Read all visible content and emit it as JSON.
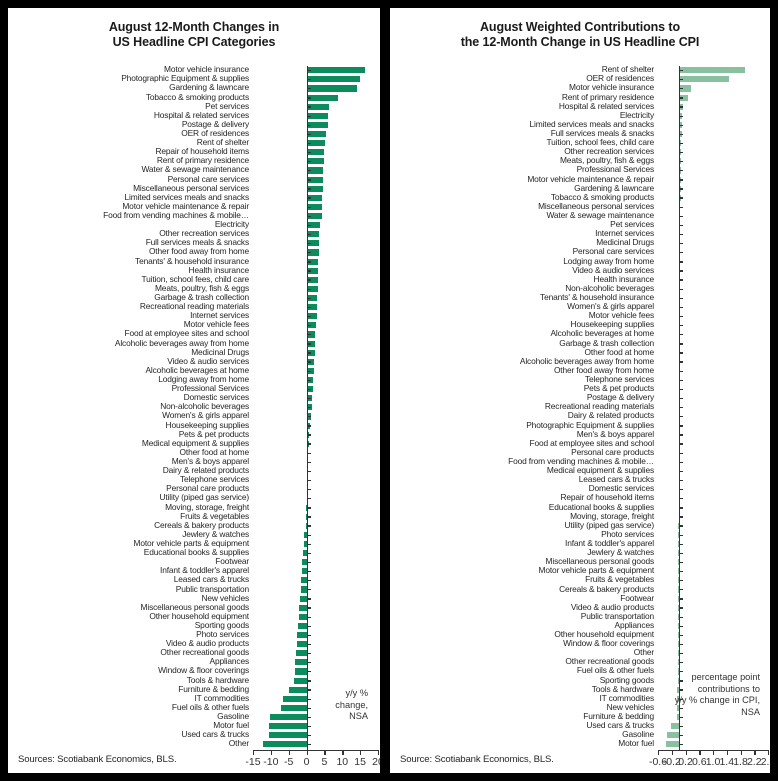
{
  "left": {
    "title_line1": "August 12-Month Changes in",
    "title_line2": "US Headline CPI Categories",
    "note": "y/y %\nchange,\nNSA",
    "source": "Sources: Scotiabank Economics, BLS.",
    "bar_color": "#0c8b5c",
    "chart_data": {
      "type": "bar",
      "title": "August 12-Month Changes in US Headline CPI Categories",
      "xlabel": "y/y % change, NSA",
      "ylabel": "",
      "orientation": "horizontal",
      "xlim": [
        -15,
        20
      ],
      "xticks": [
        -15,
        -10,
        -5,
        0,
        5,
        10,
        15,
        20
      ],
      "grid": false,
      "legend": "none",
      "categories": [
        "Motor vehicle insurance",
        "Photographic Equipment & supplies",
        "Gardening & lawncare",
        "Tobacco & smoking products",
        "Pet services",
        "Hospital & related services",
        "Postage & delivery",
        "OER of residences",
        "Rent of shelter",
        "Repair of household items",
        "Rent of  primary residence",
        "Water & sewage maintenance",
        "Personal care services",
        "Miscellaneous personal services",
        "Limited services meals and snacks",
        "Motor vehicle maintenance & repair",
        "Food from vending machines & mobile…",
        "Electricity",
        "Other recreation services",
        "Full services meals & snacks",
        "Other food away from home",
        "Tenants' & household insurance",
        "Health insurance",
        "Tuition, school fees, child care",
        "Meats, poultry, fish & eggs",
        "Garbage & trash collection",
        "Recreational reading materials",
        "Internet services",
        "Motor vehicle fees",
        "Food at employee sites and school",
        "Alcoholic beverages away from home",
        "Medicinal Drugs",
        "Video & audio services",
        "Alcoholic beverages at home",
        "Lodging away from home",
        "Professional Services",
        "Domestic services",
        "Non-alcoholic beverages",
        "Women's & girls apparel",
        "Housekeeping supplies",
        "Pets & pet products",
        "Medical equipment & supplies",
        "Other food at home",
        "Men's & boys apparel",
        "Dairy & related products",
        "Telephone services",
        "Personal care products",
        "Utility (piped gas service)",
        "Moving, storage, freight",
        "Fruits & vegetables",
        "Cereals & bakery products",
        "Jewlery & watches",
        "Motor vehicle parts & equipment",
        "Educational books & supplies",
        "Footwear",
        "Infant & toddler's apparel",
        "Leased cars & trucks",
        "Public transportation",
        "New vehicles",
        "Miscellaneous personal goods",
        "Other household equipment",
        "Sporting goods",
        "Photo services",
        "Video & audio products",
        "Other recreational goods",
        "Appliances",
        "Window & floor coverings",
        "Tools & hardware",
        "Furniture & bedding",
        "IT commodities",
        "Fuel oils & other fuels",
        "Gasoline",
        "Motor fuel",
        "Used cars & trucks",
        "Other"
      ],
      "values": [
        16.5,
        14.9,
        14.2,
        8.7,
        6.3,
        6.1,
        5.9,
        5.4,
        5.2,
        4.9,
        4.8,
        4.7,
        4.6,
        4.5,
        4.4,
        4.3,
        4.2,
        3.9,
        3.6,
        3.5,
        3.4,
        3.3,
        3.2,
        3.1,
        3.1,
        3.0,
        2.9,
        2.8,
        2.7,
        2.5,
        2.4,
        2.3,
        2.2,
        2.0,
        1.8,
        1.7,
        1.6,
        1.4,
        1.2,
        1.0,
        0.8,
        0.6,
        0.5,
        0.4,
        0.3,
        0.2,
        0.1,
        0.0,
        -0.1,
        -0.2,
        -0.3,
        -0.6,
        -0.8,
        -0.9,
        -1.2,
        -1.4,
        -1.6,
        -1.7,
        -1.9,
        -2.1,
        -2.2,
        -2.4,
        -2.6,
        -2.8,
        -2.9,
        -3.2,
        -3.3,
        -3.4,
        -5.0,
        -6.6,
        -7.2,
        -10.3,
        -10.4,
        -10.4,
        -12.3
      ]
    }
  },
  "right": {
    "title_line1": "August Weighted Contributions to",
    "title_line2": "the 12-Month Change in US Headline CPI",
    "note": "percentage point\ncontributions to\ny/y % change in CPI,\nNSA",
    "source": "Source: Scotiabank Economics, BLS.",
    "bar_color": "#88c0a0",
    "chart_data": {
      "type": "bar",
      "title": "August Weighted Contributions to the 12-Month Change in US Headline CPI",
      "xlabel": "percentage point contributions to y/y % change in CPI, NSA",
      "ylabel": "",
      "orientation": "horizontal",
      "xlim": [
        -0.6,
        2.6
      ],
      "xticks": [
        -0.6,
        -0.2,
        0.2,
        0.6,
        1.0,
        1.4,
        1.8,
        2.2,
        2.6
      ],
      "grid": false,
      "legend": "none",
      "categories": [
        "Rent of shelter",
        "OER of residences",
        "Motor vehicle insurance",
        "Rent of  primary residence",
        "Hospital & related services",
        "Electricity",
        "Limited services meals and snacks",
        "Full services meals & snacks",
        "Tuition, school fees, child care",
        "Other recreation services",
        "Meats, poultry, fish & eggs",
        "Professional Services",
        "Motor vehicle maintenance & repair",
        "Gardening & lawncare",
        "Tobacco & smoking products",
        "Miscellaneous personal services",
        "Water & sewage maintenance",
        "Pet services",
        "Internet services",
        "Medicinal Drugs",
        "Personal care services",
        "Lodging away from home",
        "Video & audio services",
        "Health insurance",
        "Non-alcoholic beverages",
        "Tenants' & household insurance",
        "Women's & girls apparel",
        "Motor vehicle fees",
        "Housekeeping supplies",
        "Alcoholic beverages at home",
        "Garbage & trash collection",
        "Other food at home",
        "Alcoholic beverages away from home",
        "Other food away from home",
        "Telephone services",
        "Pets & pet products",
        "Postage & delivery",
        "Recreational reading materials",
        "Dairy & related products",
        "Photographic Equipment & supplies",
        "Men's & boys apparel",
        "Food at employee sites and school",
        "Personal care products",
        "Food from vending machines & mobile…",
        "Medical equipment & supplies",
        "Leased cars & trucks",
        "Domestic services",
        "Repair of household items",
        "Educational books & supplies",
        "Moving, storage, freight",
        "Utility (piped gas service)",
        "Photo services",
        "Infant & toddler's apparel",
        "Jewlery & watches",
        "Miscellaneous personal goods",
        "Motor vehicle parts & equipment",
        "Fruits & vegetables",
        "Cereals & bakery products",
        "Footwear",
        "Video & audio products",
        "Public transportation",
        "Appliances",
        "Other household equipment",
        "Window & floor coverings",
        "Other",
        "Other recreational goods",
        "Fuel oils & other fuels",
        "Sporting goods",
        "Tools & hardware",
        "IT commodities",
        "New vehicles",
        "Furniture & bedding",
        "Used cars & trucks",
        "Gasoline",
        "Motor fuel"
      ],
      "values": [
        1.92,
        1.47,
        0.35,
        0.28,
        0.12,
        0.1,
        0.09,
        0.09,
        0.08,
        0.08,
        0.07,
        0.07,
        0.06,
        0.06,
        0.06,
        0.05,
        0.05,
        0.05,
        0.04,
        0.04,
        0.04,
        0.04,
        0.04,
        0.03,
        0.03,
        0.03,
        0.03,
        0.02,
        0.02,
        0.02,
        0.02,
        0.02,
        0.02,
        0.02,
        0.02,
        0.01,
        0.01,
        0.01,
        0.01,
        0.01,
        0.01,
        0.01,
        0.01,
        0.01,
        0.0,
        0.0,
        0.0,
        0.0,
        0.0,
        0.0,
        -0.01,
        -0.01,
        -0.01,
        -0.01,
        -0.01,
        -0.01,
        -0.01,
        -0.01,
        -0.01,
        -0.02,
        -0.02,
        -0.02,
        -0.02,
        -0.02,
        -0.03,
        -0.03,
        -0.03,
        -0.03,
        -0.04,
        -0.05,
        -0.05,
        -0.06,
        -0.21,
        -0.33,
        -0.36
      ]
    }
  }
}
